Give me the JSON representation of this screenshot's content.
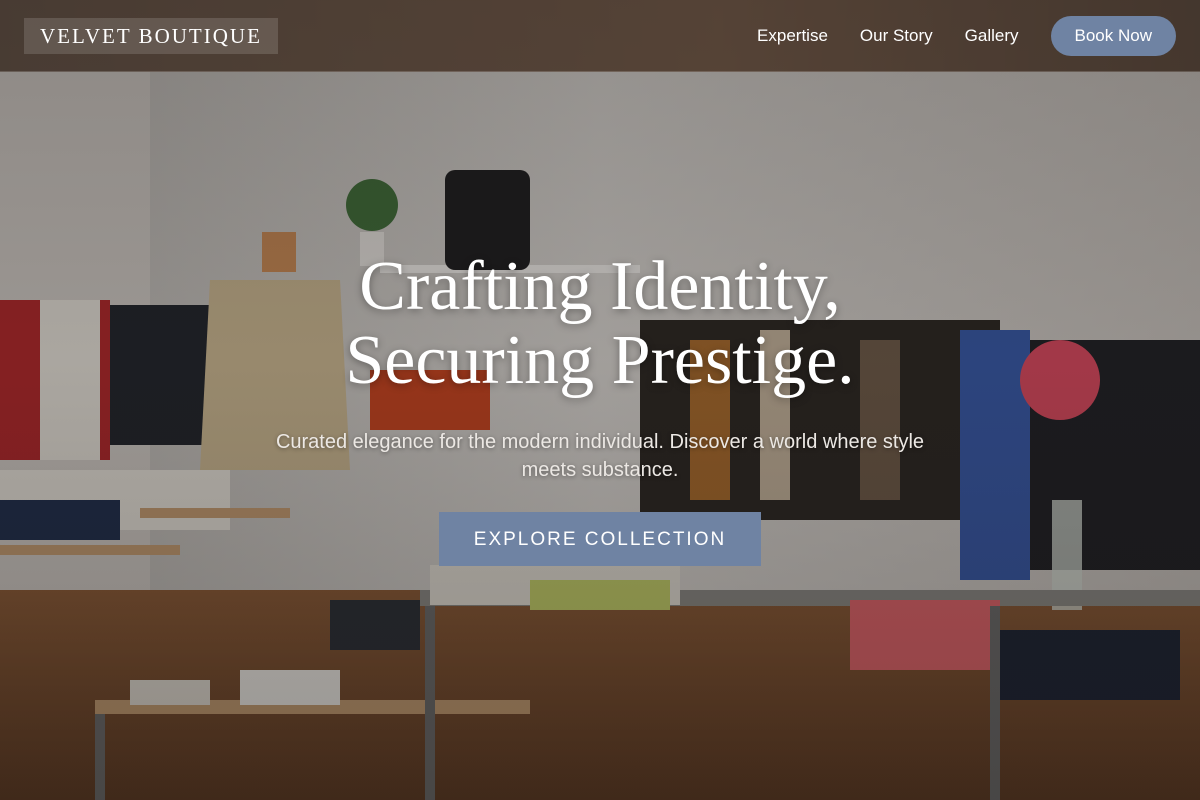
{
  "nav": {
    "logo": "VELVET BOUTIQUE",
    "links": [
      "Expertise",
      "Our Story",
      "Gallery"
    ],
    "book_label": "Book Now"
  },
  "hero": {
    "title_line1": "Crafting Identity,",
    "title_line2": "Securing Prestige.",
    "subtitle": "Curated elegance for the modern individual. Discover a world where style meets substance.",
    "cta_label": "EXPLORE COLLECTION"
  },
  "colors": {
    "accent": "#6f83a3",
    "nav_bg": "#3c3028",
    "text": "#ffffff"
  }
}
